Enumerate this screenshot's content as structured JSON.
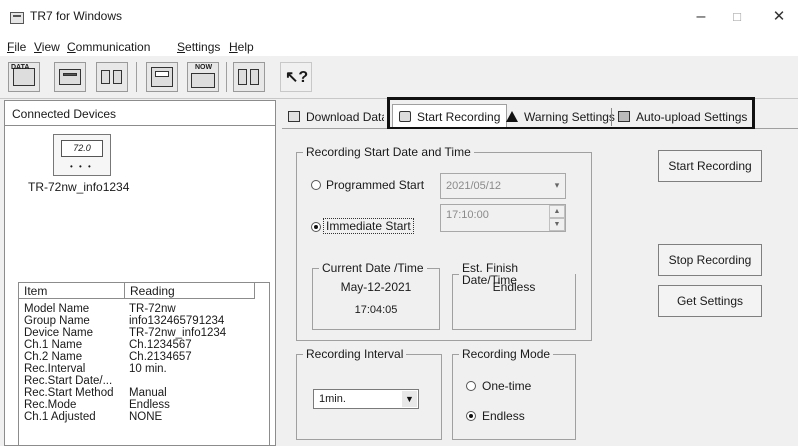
{
  "window": {
    "title": "TR7 for Windows",
    "controls": {
      "minimize": "–",
      "maximize": "□",
      "close": "✕"
    }
  },
  "menu": [
    {
      "label": "File",
      "accel": "F"
    },
    {
      "label": "View",
      "accel": "V"
    },
    {
      "label": "Communication",
      "accel": "C"
    },
    {
      "label": "Settings",
      "accel": "S"
    },
    {
      "label": "Help",
      "accel": "H"
    }
  ],
  "left_panel": {
    "title": "Connected Devices",
    "device": {
      "name": "TR-72nw_info1234",
      "display": "72.0"
    },
    "table": {
      "columns": [
        "Item",
        "Reading"
      ],
      "rows": [
        [
          "Model Name",
          "TR-72nw"
        ],
        [
          "Group Name",
          "info132465791234"
        ],
        [
          "Device Name",
          "TR-72nw_info1234"
        ],
        [
          "Ch.1 Name",
          "Ch.1234567"
        ],
        [
          "Ch.2 Name",
          "Ch.2134657"
        ],
        [
          "Rec.Interval",
          "10 min."
        ],
        [
          "Rec.Start Date/...",
          ""
        ],
        [
          "Rec.Start Method",
          "Manual"
        ],
        [
          "Rec.Mode",
          "Endless"
        ],
        [
          "Ch.1 Adjusted",
          "NONE"
        ]
      ]
    }
  },
  "tabs": [
    {
      "label": "Download Data",
      "icon": "printer-icon"
    },
    {
      "label": "Start Recording",
      "icon": "record-icon",
      "active": true
    },
    {
      "label": "Warning Settings",
      "icon": "warning-icon"
    },
    {
      "label": "Auto-upload Settings",
      "icon": "network-icon"
    }
  ],
  "start_date": {
    "legend": "Recording Start Date and Time",
    "programmed_label": "Programmed Start",
    "programmed_date": "2021/05/12",
    "immediate_label": "Immediate Start",
    "time": "17:10:00",
    "selected": "immediate"
  },
  "current_date": {
    "legend": "Current Date /Time",
    "date": "May-12-2021",
    "time": "17:04:05"
  },
  "finish_date": {
    "legend": "Est. Finish Date/Time",
    "value": "Endless"
  },
  "interval": {
    "legend": "Recording Interval",
    "value": "1min."
  },
  "mode": {
    "legend": "Recording Mode",
    "one_time": "One-time",
    "endless": "Endless",
    "selected": "endless"
  },
  "buttons": {
    "start": "Start Recording",
    "stop": "Stop Recording",
    "get": "Get Settings"
  },
  "colors": {
    "highlight_frame": "#111111",
    "background": "#f0f0f0"
  }
}
